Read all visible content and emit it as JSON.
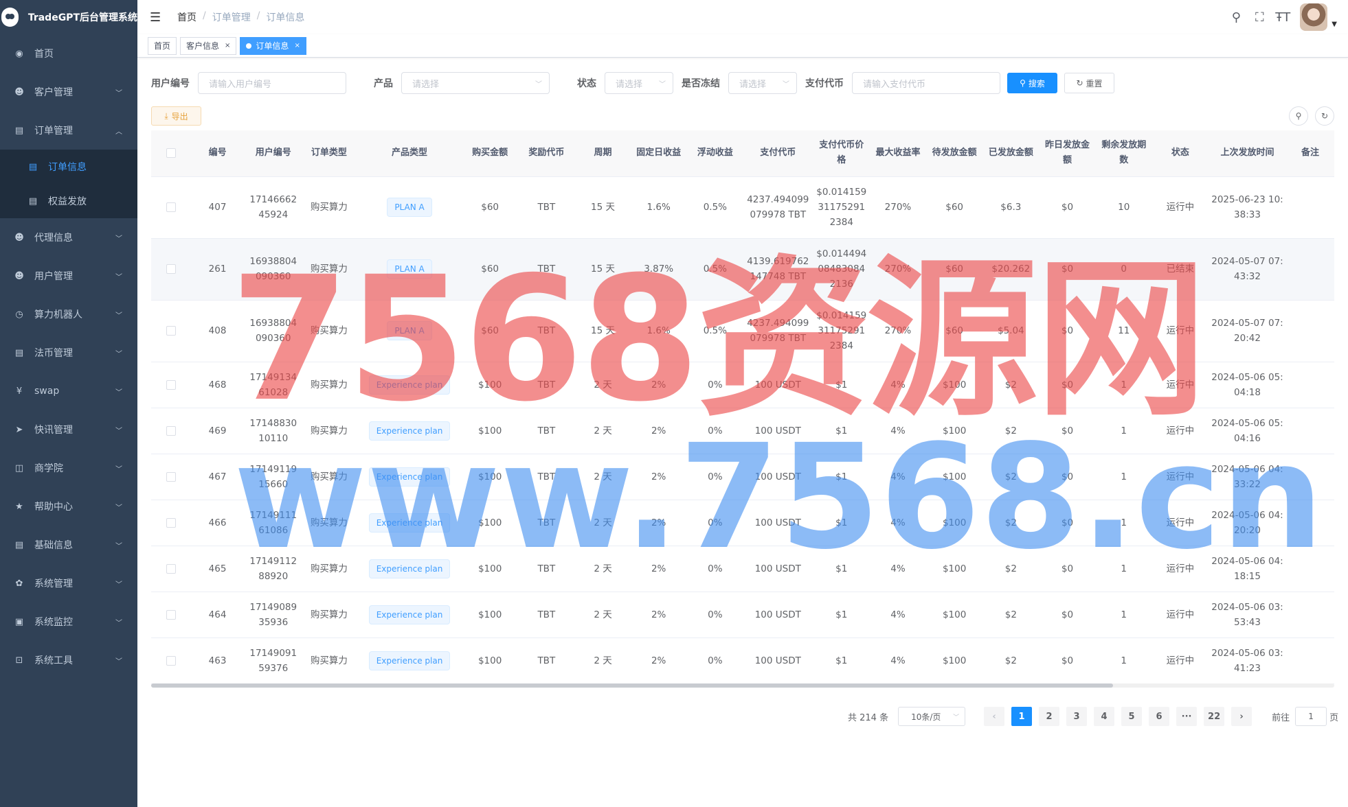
{
  "app": {
    "title": "TradeGPT后台管理系统"
  },
  "sidebar": {
    "items": [
      {
        "label": "首页",
        "icon": "dashboard-icon",
        "glyph": "◉",
        "has_children": false
      },
      {
        "label": "客户管理",
        "icon": "user-icon",
        "glyph": "☻",
        "has_children": true
      },
      {
        "label": "订单管理",
        "icon": "document-icon",
        "glyph": "▤",
        "has_children": true,
        "expanded": true,
        "children": [
          {
            "label": "订单信息",
            "icon": "document-icon",
            "glyph": "▤",
            "active": true
          },
          {
            "label": "权益发放",
            "icon": "document-icon",
            "glyph": "▤",
            "active": false
          }
        ]
      },
      {
        "label": "代理信息",
        "icon": "user-icon",
        "glyph": "☻",
        "has_children": true
      },
      {
        "label": "用户管理",
        "icon": "user-icon",
        "glyph": "☻",
        "has_children": true
      },
      {
        "label": "算力机器人",
        "icon": "clock-icon",
        "glyph": "◷",
        "has_children": true
      },
      {
        "label": "法币管理",
        "icon": "document-icon",
        "glyph": "▤",
        "has_children": true
      },
      {
        "label": "swap",
        "icon": "yen-icon",
        "glyph": "¥",
        "has_children": true
      },
      {
        "label": "快讯管理",
        "icon": "send-icon",
        "glyph": "➤",
        "has_children": true
      },
      {
        "label": "商学院",
        "icon": "book-icon",
        "glyph": "◫",
        "has_children": true
      },
      {
        "label": "帮助中心",
        "icon": "star-icon",
        "glyph": "★",
        "has_children": true
      },
      {
        "label": "基础信息",
        "icon": "document-icon",
        "glyph": "▤",
        "has_children": true
      },
      {
        "label": "系统管理",
        "icon": "gear-icon",
        "glyph": "✿",
        "has_children": true
      },
      {
        "label": "系统监控",
        "icon": "monitor-icon",
        "glyph": "▣",
        "has_children": true
      },
      {
        "label": "系统工具",
        "icon": "toolbox-icon",
        "glyph": "⊡",
        "has_children": true
      }
    ]
  },
  "navbar": {
    "breadcrumb": [
      "首页",
      "订单管理",
      "订单信息"
    ],
    "icons": [
      "search-icon",
      "fullscreen-icon",
      "font-size-icon"
    ]
  },
  "tags": [
    {
      "label": "首页",
      "closable": false,
      "active": false
    },
    {
      "label": "客户信息",
      "closable": true,
      "active": false
    },
    {
      "label": "订单信息",
      "closable": true,
      "active": true
    }
  ],
  "search": {
    "user_id_label": "用户编号",
    "user_id_placeholder": "请输入用户编号",
    "product_label": "产品",
    "product_placeholder": "请选择",
    "status_label": "状态",
    "status_placeholder": "请选择",
    "frozen_label": "是否冻结",
    "frozen_placeholder": "请选择",
    "pay_token_label": "支付代币",
    "pay_token_placeholder": "请输入支付代币",
    "search_button": "搜索",
    "reset_button": "重置"
  },
  "toolbar": {
    "export_label": "导出"
  },
  "table": {
    "columns": [
      "编号",
      "用户编号",
      "订单类型",
      "产品类型",
      "购买金额",
      "奖励代币",
      "周期",
      "固定日收益",
      "浮动收益",
      "支付代币",
      "支付代币价格",
      "最大收益率",
      "待发放金额",
      "已发放金额",
      "昨日发放金额",
      "剩余发放期数",
      "状态",
      "上次发放时间",
      "备注"
    ],
    "rows": [
      [
        "407",
        "1714666245924",
        "购买算力",
        "PLAN A",
        "$60",
        "TBT",
        "15 天",
        "1.6%",
        "0.5%",
        "4237.494099079978 TBT",
        "$0.014159311752912384",
        "270%",
        "$60",
        "$6.3",
        "$0",
        "10",
        "运行中",
        "2025-06-23 10:38:33",
        ""
      ],
      [
        "261",
        "16938804090360",
        "购买算力",
        "PLAN A",
        "$60",
        "TBT",
        "15 天",
        "3.87%",
        "0.5%",
        "4139.619762147748 TBT",
        "$0.014494084830842136",
        "270%",
        "$60",
        "$20.262",
        "$0",
        "0",
        "已结束",
        "2024-05-07 07:43:32",
        ""
      ],
      [
        "408",
        "16938804090360",
        "购买算力",
        "PLAN A",
        "$60",
        "TBT",
        "15 天",
        "1.6%",
        "0.5%",
        "4237.494099079978 TBT",
        "$0.014159311752912384",
        "270%",
        "$60",
        "$5.04",
        "$0",
        "11",
        "运行中",
        "2024-05-07 07:20:42",
        ""
      ],
      [
        "468",
        "1714913461028",
        "购买算力",
        "Experience plan",
        "$100",
        "TBT",
        "2 天",
        "2%",
        "0%",
        "100 USDT",
        "$1",
        "4%",
        "$100",
        "$2",
        "$0",
        "1",
        "运行中",
        "2024-05-06 05:04:18",
        ""
      ],
      [
        "469",
        "1714883010110",
        "购买算力",
        "Experience plan",
        "$100",
        "TBT",
        "2 天",
        "2%",
        "0%",
        "100 USDT",
        "$1",
        "4%",
        "$100",
        "$2",
        "$0",
        "1",
        "运行中",
        "2024-05-06 05:04:16",
        ""
      ],
      [
        "467",
        "1714911915660",
        "购买算力",
        "Experience plan",
        "$100",
        "TBT",
        "2 天",
        "2%",
        "0%",
        "100 USDT",
        "$1",
        "4%",
        "$100",
        "$2",
        "$0",
        "1",
        "运行中",
        "2024-05-06 04:33:22",
        ""
      ],
      [
        "466",
        "1714911161086",
        "购买算力",
        "Experience plan",
        "$100",
        "TBT",
        "2 天",
        "2%",
        "0%",
        "100 USDT",
        "$1",
        "4%",
        "$100",
        "$2",
        "$0",
        "1",
        "运行中",
        "2024-05-06 04:20:20",
        ""
      ],
      [
        "465",
        "1714911288920",
        "购买算力",
        "Experience plan",
        "$100",
        "TBT",
        "2 天",
        "2%",
        "0%",
        "100 USDT",
        "$1",
        "4%",
        "$100",
        "$2",
        "$0",
        "1",
        "运行中",
        "2024-05-06 04:18:15",
        ""
      ],
      [
        "464",
        "1714908935936",
        "购买算力",
        "Experience plan",
        "$100",
        "TBT",
        "2 天",
        "2%",
        "0%",
        "100 USDT",
        "$1",
        "4%",
        "$100",
        "$2",
        "$0",
        "1",
        "运行中",
        "2024-05-06 03:53:43",
        ""
      ],
      [
        "463",
        "1714909159376",
        "购买算力",
        "Experience plan",
        "$100",
        "TBT",
        "2 天",
        "2%",
        "0%",
        "100 USDT",
        "$1",
        "4%",
        "$100",
        "$2",
        "$0",
        "1",
        "运行中",
        "2024-05-06 03:41:23",
        ""
      ]
    ]
  },
  "pagination": {
    "total_label": "共 214 条",
    "page_size": "10条/页",
    "pages": [
      "1",
      "2",
      "3",
      "4",
      "5",
      "6",
      "···",
      "22"
    ],
    "current": "1",
    "prev": "‹",
    "next": "›",
    "goto_label": "前往",
    "goto_value": "1",
    "page_suffix": "页"
  },
  "watermark": {
    "line1": "7568资源网",
    "line2": "www.7568.cn"
  },
  "colors": {
    "sidebar_bg": "#304156",
    "primary": "#1890ff",
    "active_menu": "#409eff",
    "export": "#e6a23c"
  }
}
